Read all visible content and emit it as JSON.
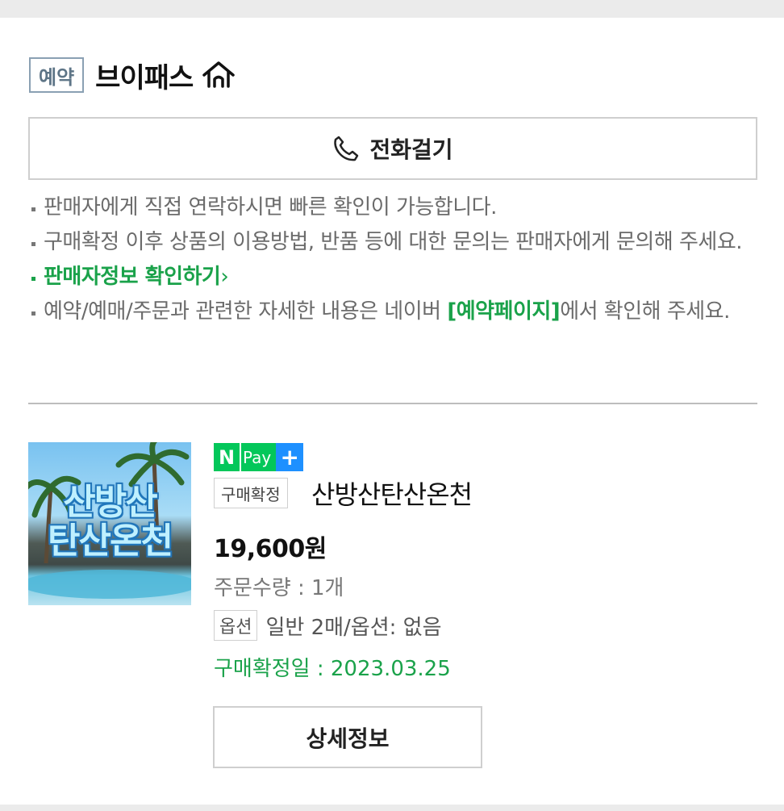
{
  "seller": {
    "badge": "예약",
    "name": "브이패스",
    "home_icon": "home-icon"
  },
  "call_button": {
    "icon": "phone-icon",
    "label": "전화걸기"
  },
  "notices": {
    "line1": "판매자에게 직접 연락하시면 빠른 확인이 가능합니다.",
    "line2": "구매확정 이후 상품의 이용방법, 반품 등에 대한 문의는 판매자에게 문의해 주세요.",
    "seller_info_link": "판매자정보 확인하기",
    "seller_info_chevron": "›",
    "line4_before": "예약/예매/주문과 관련한 자세한 내용은 네이버 ",
    "line4_link": "[예약페이지]",
    "line4_after": "에서 확인해 주세요."
  },
  "product": {
    "thumb_text_line1": "산방산",
    "thumb_text_line2": "탄산온천",
    "npay_n": "N",
    "npay_pay": "Pay",
    "npay_plus": "+",
    "status_badge": "구매확정",
    "name": "산방산탄산온천",
    "price": "19,600원",
    "quantity": "주문수량 : 1개",
    "option_badge": "옵션",
    "option_text": "일반 2매/옵션: 없음",
    "confirm_date": "구매확정일 : 2023.03.25",
    "detail_button": "상세정보"
  },
  "colors": {
    "accent_green": "#1aa24a",
    "npay_green": "#03c75a",
    "npay_blue": "#1e90ff",
    "badge_border": "#8aa0b3"
  }
}
